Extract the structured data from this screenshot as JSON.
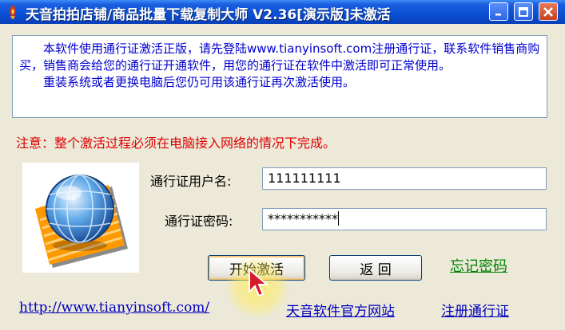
{
  "window": {
    "title": "天音拍拍店铺/商品批量下载复制大师 V2.36[演示版]未激活"
  },
  "notice": {
    "paragraph1": "本软件使用通行证激活正版，请先登陆www.tianyinsoft.com注册通行证，联系软件销售商购买，销售商会给您的通行证开通软件，用您的通行证在软件中激活即可正常使用。",
    "paragraph2": "重装系统或者更换电脑后您仍可用该通行证再次激活使用。"
  },
  "warning": "注意：整个激活过程必须在电脑接入网络的情况下完成。",
  "form": {
    "username_label": "通行证用户名:",
    "username_value": "111111111",
    "password_label": "通行证密码:",
    "password_value": "***********"
  },
  "buttons": {
    "activate": "开始激活",
    "back": "返 回",
    "forgot_password": "忘记密码"
  },
  "footer": {
    "url": "http://www.tianyinsoft.com/",
    "official_site": "天音软件官方网站",
    "register": "注册通行证"
  },
  "colors": {
    "notice_text": "#0000d0",
    "warning_text": "#e00000",
    "link_green": "#008000",
    "link_blue": "#0000c0",
    "titlebar": "#0a4fd4"
  },
  "icons": {
    "app": "rocket-flame-icon",
    "logo": "globe-on-document-icon",
    "cursor": "mouse-pointer-icon"
  }
}
